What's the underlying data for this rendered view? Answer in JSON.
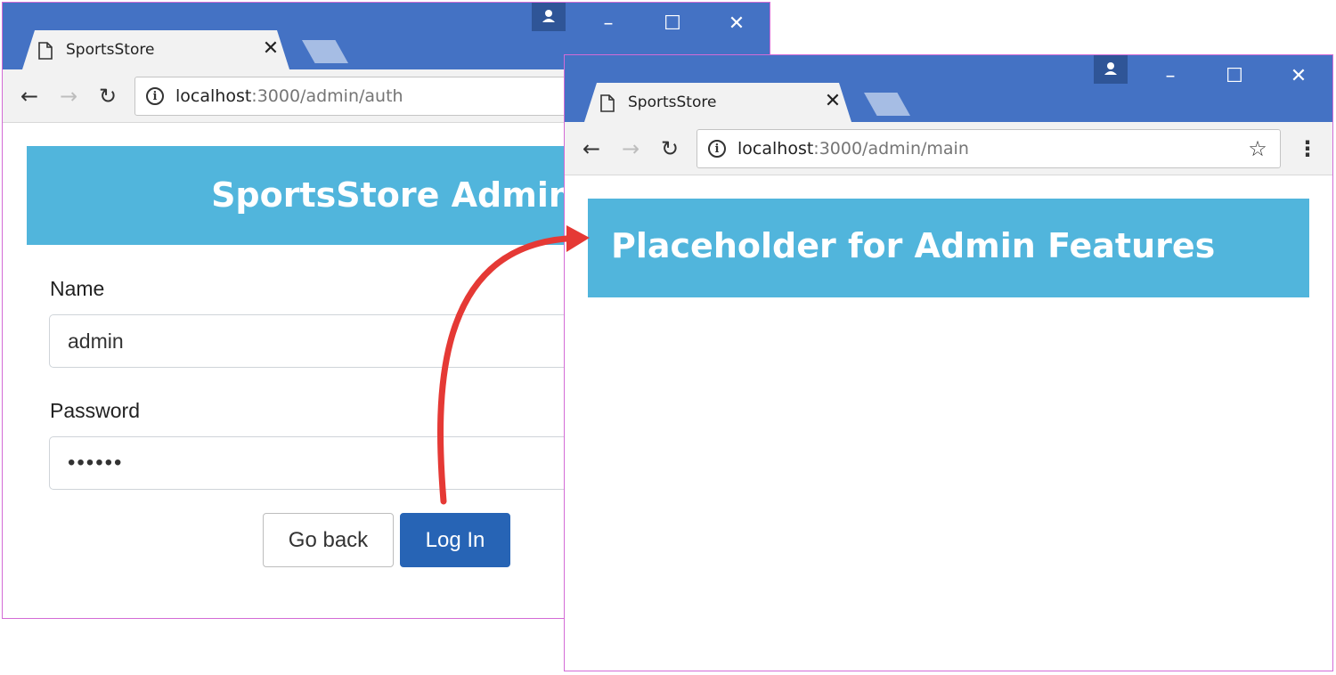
{
  "windows": {
    "left": {
      "tab_title": "SportsStore",
      "url_host": "localhost",
      "url_rest": ":3000/admin/auth",
      "page": {
        "banner": "SportsStore Admin",
        "name_label": "Name",
        "name_value": "admin",
        "password_label": "Password",
        "password_value": "••••••",
        "go_back_label": "Go back",
        "login_label": "Log In"
      }
    },
    "right": {
      "tab_title": "SportsStore",
      "url_host": "localhost",
      "url_rest": ":3000/admin/main",
      "page": {
        "banner": "Placeholder for Admin Features"
      }
    }
  },
  "icons": {
    "page": "page-icon",
    "close": "close-icon",
    "profile": "profile-icon",
    "minimize": "minimize-icon",
    "maximize": "maximize-icon",
    "window_close": "window-close-icon",
    "back": "back-arrow-icon",
    "forward": "forward-arrow-icon",
    "reload": "reload-icon",
    "info": "info-icon",
    "star": "star-icon",
    "menu": "menu-icon"
  },
  "colors": {
    "titlebar": "#4472c4",
    "banner": "#51b5dc",
    "primary_button": "#2764b5",
    "arrow": "#e53935",
    "window_border": "#d36bd6"
  }
}
